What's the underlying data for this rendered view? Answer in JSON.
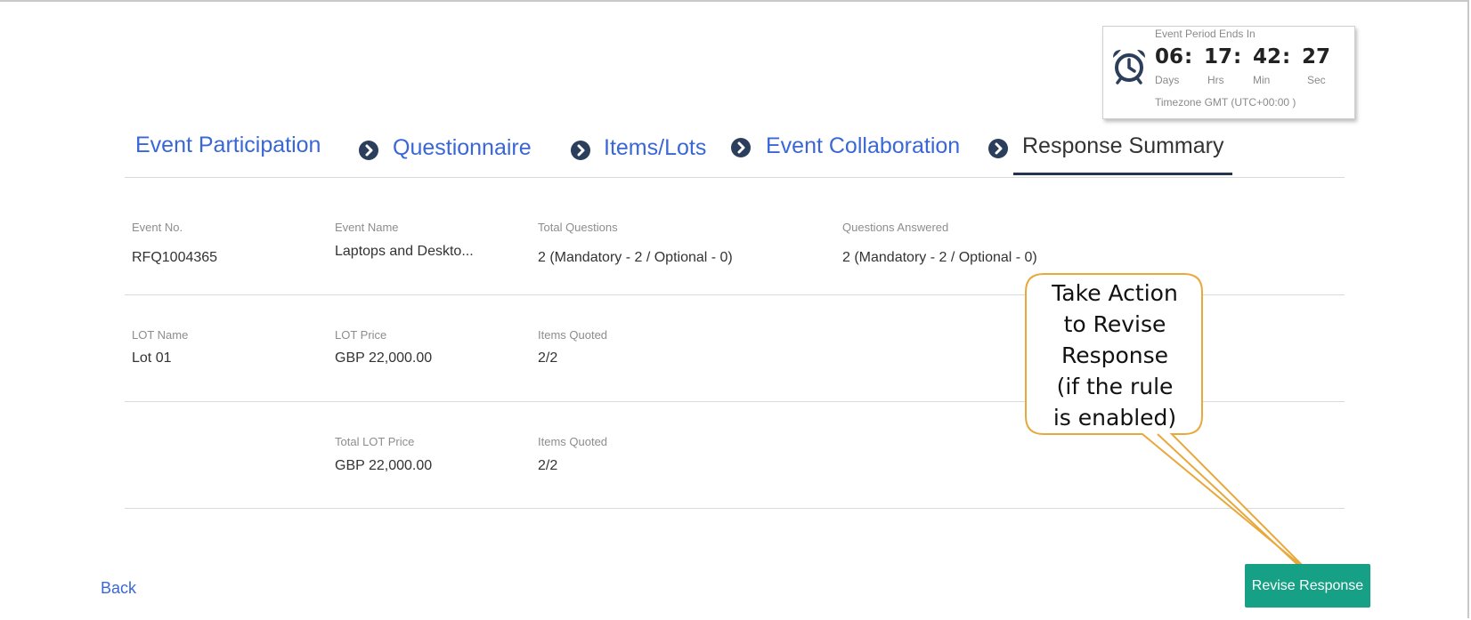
{
  "timer": {
    "caption": "Event Period Ends In",
    "days": "06",
    "hrs": "17",
    "min": "42",
    "sec": "27",
    "sep": ":",
    "unit_days": "Days",
    "unit_hrs": "Hrs",
    "unit_min": "Min",
    "unit_sec": "Sec",
    "timezone": "Timezone GMT (UTC+00:00 )",
    "icon": "alarm-clock-icon"
  },
  "steps": [
    {
      "label": "Event Participation"
    },
    {
      "label": "Questionnaire"
    },
    {
      "label": "Items/Lots"
    },
    {
      "label": "Event Collaboration"
    },
    {
      "label": "Response Summary"
    }
  ],
  "summary": {
    "event_no_label": "Event No.",
    "event_no": "RFQ1004365",
    "event_name_label": "Event Name",
    "event_name": "Laptops and Deskto...",
    "total_questions_label": "Total Questions",
    "total_questions": "2 (Mandatory - 2 / Optional - 0)",
    "questions_answered_label": "Questions Answered",
    "questions_answered": "2 (Mandatory - 2 / Optional - 0)"
  },
  "lot": {
    "name_label": "LOT Name",
    "name": "Lot 01",
    "price_label": "LOT Price",
    "price": "GBP 22,000.00",
    "items_label": "Items Quoted",
    "items": "2/2"
  },
  "total": {
    "price_label": "Total LOT Price",
    "price": "GBP 22,000.00",
    "items_label": "Items Quoted",
    "items": "2/2"
  },
  "callout": {
    "lines": [
      "Take Action",
      "to Revise",
      "Response",
      "(if the rule",
      "is enabled)"
    ]
  },
  "actions": {
    "back": "Back",
    "revise": "Revise Response"
  },
  "colors": {
    "link": "#3a67d6",
    "primary_button": "#16a085",
    "callout_border": "#e8a93c"
  }
}
